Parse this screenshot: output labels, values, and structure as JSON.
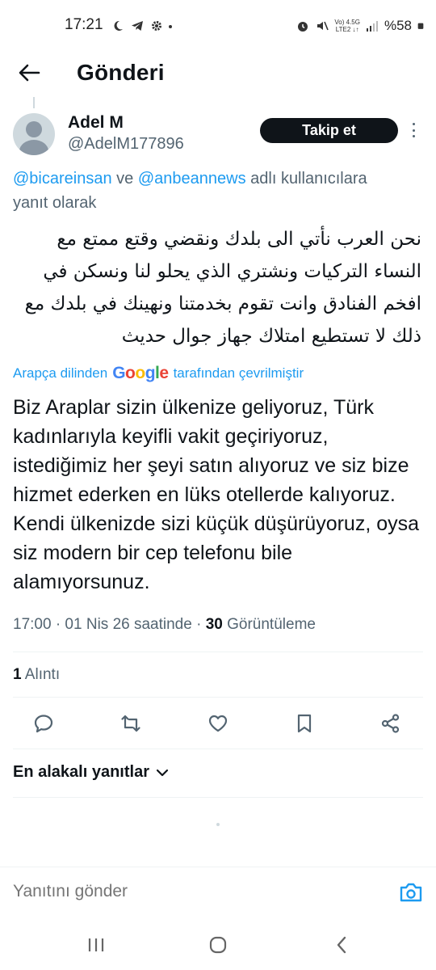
{
  "status_bar": {
    "time": "17:21",
    "network_top": "Vo) 4.5G",
    "network_bottom": "LTE2 ↓↑",
    "battery": "%58"
  },
  "header": {
    "title": "Gönderi"
  },
  "post": {
    "display_name": "Adel M",
    "handle": "@AdelM177896",
    "follow_label": "Takip et",
    "reply_mention_1": "@bicareinsan",
    "reply_and": " ve ",
    "reply_mention_2": "@anbeannews",
    "reply_suffix": " adlı kullanıcılara",
    "reply_line2": "yanıt olarak",
    "arabic_text": "نحن العرب نأتي الى بلدك ونقضي وقتع ممتع مع النساء التركيات ونشتري الذي يحلو لنا ونسكن في افخم الفنادق وانت تقوم بخدمتنا ونهينك في بلدك مع ذلك لا تستطيع امتلاك جهاز جوال حديث",
    "translate_prefix": "Arapça dilinden",
    "translate_brand": "Google",
    "translate_suffix": "tarafından çevrilmiştir",
    "translation": "Biz Araplar sizin ülkenize geliyoruz, Türk kadınlarıyla keyifli vakit geçiriyoruz, istediğimiz her şeyi satın alıyoruz ve siz bize hizmet ederken en lüks otellerde kalıyoruz. Kendi ülkenizde sizi küçük düşürüyoruz, oysa siz modern bir cep telefonu bile alamıyorsunuz.",
    "timestamp": "17:00 · 01 Nis 26 saatinde · ",
    "views_count": "30",
    "views_label": " Görüntüleme",
    "quotes_count": "1",
    "quotes_label": " Alıntı"
  },
  "actions": {
    "icons": [
      "reply-icon",
      "retweet-icon",
      "like-icon",
      "bookmark-icon",
      "share-icon"
    ]
  },
  "replies": {
    "sort_label": "En alakalı yanıtlar"
  },
  "composer": {
    "placeholder": "Yanıtını gönder"
  },
  "colors": {
    "accent": "#1d9bf0",
    "text": "#0f1419",
    "secondary": "#536471"
  }
}
